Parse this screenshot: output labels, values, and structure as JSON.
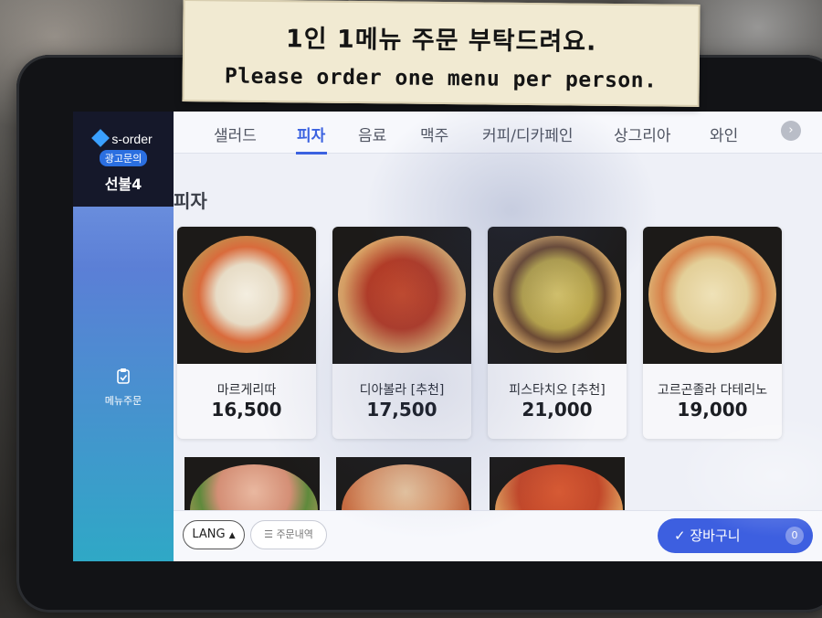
{
  "sign": {
    "line1": "1인 1메뉴 주문 부탁드려요.",
    "line2": "Please order one menu per person."
  },
  "sidebar": {
    "brand": "s-order",
    "ad_badge": "광고문의",
    "store_name": "선불4",
    "menu_order_label": "메뉴주문",
    "menu_order_icon": "clipboard-icon"
  },
  "tabs": [
    {
      "label": "샐러드",
      "active": false
    },
    {
      "label": "피자",
      "active": true
    },
    {
      "label": "음료",
      "active": false
    },
    {
      "label": "맥주",
      "active": false
    },
    {
      "label": "커피/디카페인",
      "active": false
    },
    {
      "label": "상그리아",
      "active": false
    },
    {
      "label": "와인",
      "active": false
    }
  ],
  "section_title": "피자",
  "menu_items": [
    {
      "name": "마르게리따",
      "price": "16,500"
    },
    {
      "name": "디아볼라 [추천]",
      "price": "17,500"
    },
    {
      "name": "피스타치오 [추천]",
      "price": "21,000"
    },
    {
      "name": "고르곤졸라 다테리노",
      "price": "19,000"
    }
  ],
  "bottom": {
    "lang_label": "LANG",
    "history_label": "주문내역",
    "cart_label": "장바구니",
    "cart_count": "0"
  },
  "colors": {
    "accent": "#3b62e0",
    "sidebar_dark": "#15182a"
  }
}
